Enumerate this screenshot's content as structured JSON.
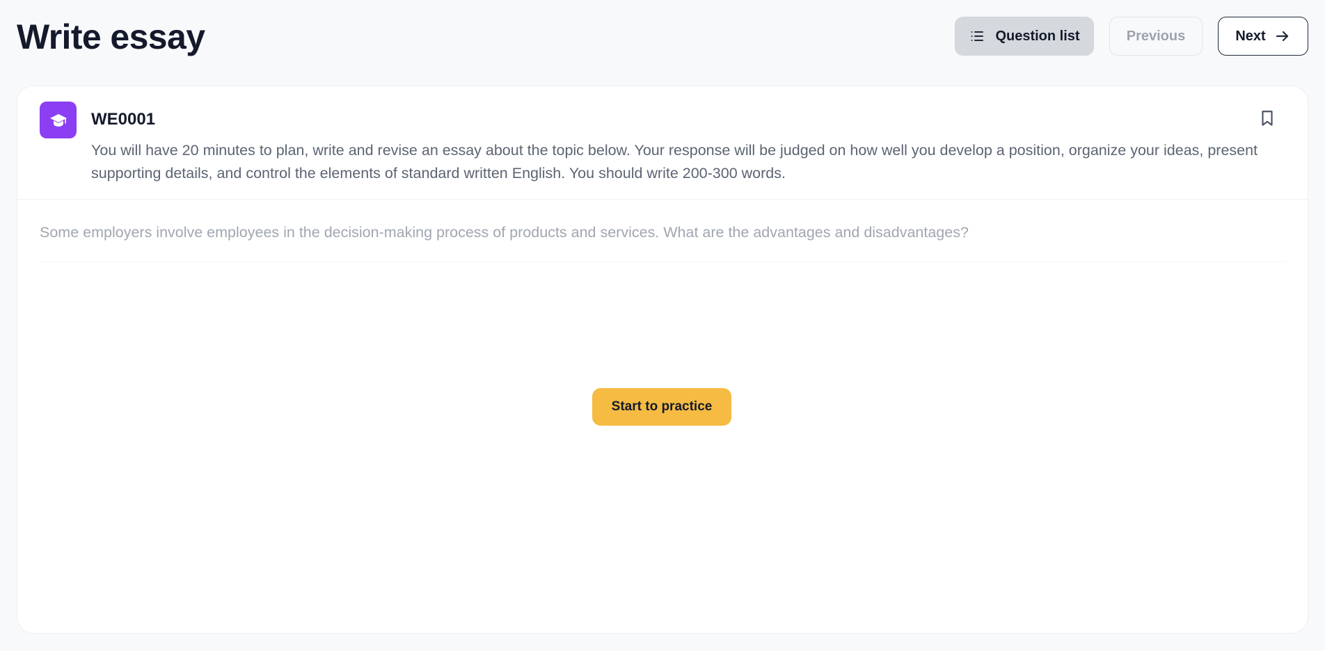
{
  "header": {
    "title": "Write essay",
    "question_list_label": "Question list",
    "question_list_icon": "list-icon",
    "previous_label": "Previous",
    "next_label": "Next",
    "next_icon": "arrow-right-icon"
  },
  "question": {
    "code": "WE0001",
    "category_icon": "graduation-cap-icon",
    "bookmark_icon": "bookmark-icon",
    "instructions": "You will have 20 minutes to plan, write and revise an essay about the topic below. Your response will be judged on how well you develop a position, organize your ideas, present supporting details, and control the elements of standard written English. You should write 200-300 words.",
    "prompt": "Some employers involve employees in the decision-making process of products and services. What are the advantages and disadvantages?"
  },
  "practice": {
    "start_label": "Start to practice"
  },
  "colors": {
    "page_background": "#f8f9fb",
    "card_background": "#ffffff",
    "accent_purple": "#8b3ef2",
    "practice_yellow": "#f5bb42",
    "question_list_background": "#d5d8dd",
    "disabled_text": "#9ca3af"
  }
}
